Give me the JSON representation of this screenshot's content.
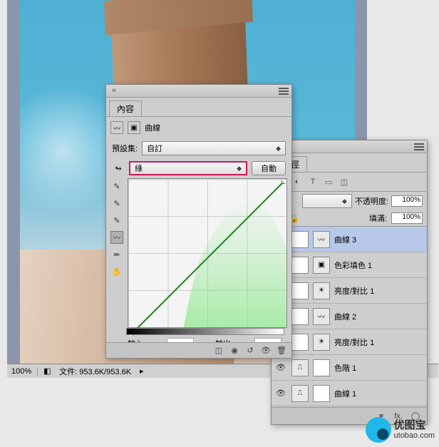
{
  "status": {
    "zoom": "100%",
    "docinfo": "文件: 953.6K/953.6K"
  },
  "properties": {
    "tab": "內容",
    "adjustment": "曲線",
    "preset_label": "預設集:",
    "preset_value": "自訂",
    "channel_value": "綠",
    "auto_btn": "自動",
    "input_label": "輸入:",
    "output_label": "輸出:"
  },
  "layers": {
    "tab": "路徑",
    "blend_mode": "不透明度:",
    "opacity": "100%",
    "fill_label": "填滿:",
    "fill": "100%",
    "items": [
      {
        "name": "曲線 3",
        "selected": true
      },
      {
        "name": "色彩填色 1",
        "selected": false
      },
      {
        "name": "亮度/對比 1",
        "selected": false
      },
      {
        "name": "曲線 2",
        "selected": false
      },
      {
        "name": "亮度/對比 1",
        "selected": false
      },
      {
        "name": "色階 1",
        "selected": false
      },
      {
        "name": "曲線 1",
        "selected": false
      }
    ]
  },
  "watermark": {
    "name": "优图宝",
    "url": "utobao.com"
  }
}
